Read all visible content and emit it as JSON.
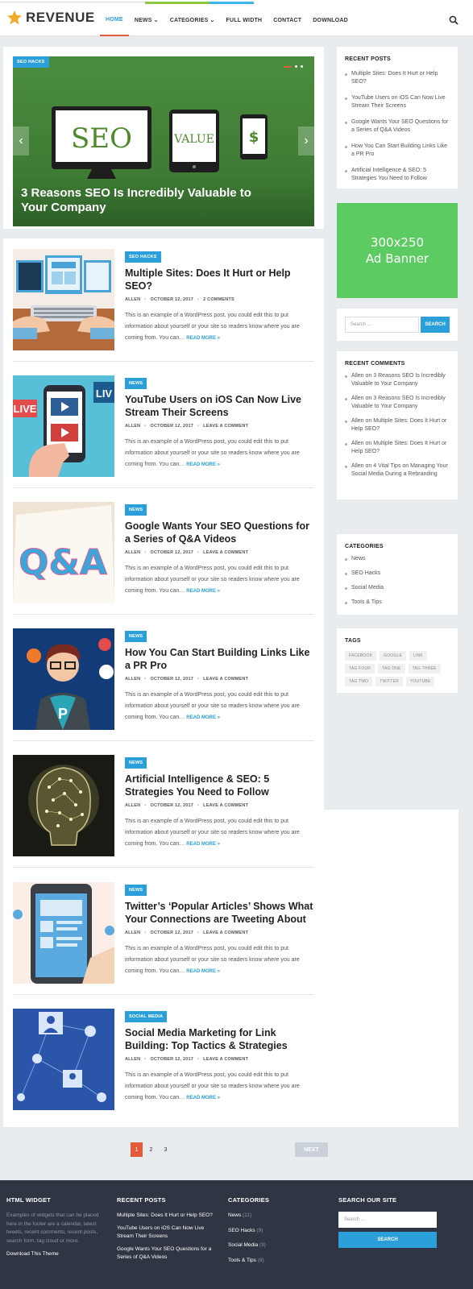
{
  "site": {
    "logo_text": "REVENUE"
  },
  "nav": {
    "items": [
      {
        "label": "HOME",
        "active": true,
        "dropdown": false
      },
      {
        "label": "NEWS",
        "active": false,
        "dropdown": true
      },
      {
        "label": "CATEGORIES",
        "active": false,
        "dropdown": true
      },
      {
        "label": "FULL WIDTH",
        "active": false,
        "dropdown": false
      },
      {
        "label": "CONTACT",
        "active": false,
        "dropdown": false
      },
      {
        "label": "DOWNLOAD",
        "active": false,
        "dropdown": false
      }
    ],
    "search_icon": "search-icon"
  },
  "slider": {
    "tag": "SEO HACKS",
    "title": "3 Reasons SEO Is Incredibly Valuable to Your Company",
    "screen_words": [
      "SEO",
      "VALUE",
      "$"
    ],
    "prev_icon": "chevron-left-icon",
    "next_icon": "chevron-right-icon"
  },
  "posts": [
    {
      "category": "SEO HACKS",
      "title": "Multiple Sites: Does It Hurt or Help SEO?",
      "author": "ALLEN",
      "date": "OCTOBER 12, 2017",
      "comments": "2 COMMENTS",
      "excerpt": "This is an example of a WordPress post, you could edit this to put information about yourself or your site so readers know where you are coming from. You can…",
      "read_more": "READ MORE »"
    },
    {
      "category": "NEWS",
      "title": "YouTube Users on iOS Can Now Live Stream Their Screens",
      "author": "ALLEN",
      "date": "OCTOBER 12, 2017",
      "comments": "LEAVE A COMMENT",
      "excerpt": "This is an example of a WordPress post, you could edit this to put information about yourself or your site so readers know where you are coming from. You can…",
      "read_more": "READ MORE »"
    },
    {
      "category": "NEWS",
      "title": "Google Wants Your SEO Questions for a Series of Q&A Videos",
      "author": "ALLEN",
      "date": "OCTOBER 12, 2017",
      "comments": "LEAVE A COMMENT",
      "excerpt": "This is an example of a WordPress post, you could edit this to put information about yourself or your site so readers know where you are coming from. You can…",
      "read_more": "READ MORE »"
    },
    {
      "category": "NEWS",
      "title": "How You Can Start Building Links Like a PR Pro",
      "author": "ALLEN",
      "date": "OCTOBER 12, 2017",
      "comments": "LEAVE A COMMENT",
      "excerpt": "This is an example of a WordPress post, you could edit this to put information about yourself or your site so readers know where you are coming from. You can…",
      "read_more": "READ MORE »"
    },
    {
      "category": "NEWS",
      "title": "Artificial Intelligence & SEO: 5 Strategies You Need to Follow",
      "author": "ALLEN",
      "date": "OCTOBER 12, 2017",
      "comments": "LEAVE A COMMENT",
      "excerpt": "This is an example of a WordPress post, you could edit this to put information about yourself or your site so readers know where you are coming from. You can…",
      "read_more": "READ MORE »"
    },
    {
      "category": "NEWS",
      "title": "Twitter’s ‘Popular Articles’ Shows What Your Connections are Tweeting About",
      "author": "ALLEN",
      "date": "OCTOBER 12, 2017",
      "comments": "LEAVE A COMMENT",
      "excerpt": "This is an example of a WordPress post, you could edit this to put information about yourself or your site so readers know where you are coming from. You can…",
      "read_more": "READ MORE »"
    },
    {
      "category": "SOCIAL MEDIA",
      "title": "Social Media Marketing for Link Building: Top Tactics & Strategies",
      "author": "ALLEN",
      "date": "OCTOBER 12, 2017",
      "comments": "LEAVE A COMMENT",
      "excerpt": "This is an example of a WordPress post, you could edit this to put information about yourself or your site so readers know where you are coming from. You can…",
      "read_more": "READ MORE »"
    }
  ],
  "thumb_art": {
    "qa_text": "Q&A",
    "live_text": "LIVE",
    "live_short": "LIV",
    "hero_letter": "P"
  },
  "pagination": {
    "pages": [
      "1",
      "2",
      "3"
    ],
    "current": "1",
    "next": "NEXT"
  },
  "sidebar": {
    "recent_posts": {
      "title": "RECENT POSTS",
      "items": [
        "Multiple Sites: Does It Hurt or Help SEO?",
        "YouTube Users on iOS Can Now Live Stream Their Screens",
        "Google Wants Your SEO Questions for a Series of Q&A Videos",
        "How You Can Start Building Links Like a PR Pro",
        "Artificial Intelligence & SEO: 5 Strategies You Need to Follow"
      ]
    },
    "ad": {
      "line1": "300x250",
      "line2": "Ad Banner",
      "color": "#5ccc62"
    },
    "search": {
      "placeholder": "Search …",
      "button": "SEARCH"
    },
    "recent_comments": {
      "title": "RECENT COMMENTS",
      "items": [
        {
          "author": "Allen",
          "on": "on",
          "post": "3 Reasons SEO Is Incredibly Valuable to Your Company"
        },
        {
          "author": "Allen",
          "on": "on",
          "post": "3 Reasons SEO Is Incredibly Valuable to Your Company"
        },
        {
          "author": "Allen",
          "on": "on",
          "post": "Multiple Sites: Does It Hurt or Help SEO?"
        },
        {
          "author": "Allen",
          "on": "on",
          "post": "Multiple Sites: Does It Hurt or Help SEO?"
        },
        {
          "author": "Allen",
          "on": "on",
          "post": "4 Vital Tips on Managing Your Social Media During a Rebranding"
        }
      ]
    },
    "categories": {
      "title": "CATEGORIES",
      "items": [
        "News",
        "SEO Hacks",
        "Social Media",
        "Tools & Tips"
      ]
    },
    "tags": {
      "title": "TAGS",
      "items": [
        "FACEBOOK",
        "GOOGLE",
        "LINK",
        "TAG FOUR",
        "TAG ONE",
        "TAG THREE",
        "TAG TWO",
        "TWITTER",
        "YOUTUBE"
      ]
    }
  },
  "footer": {
    "html_widget": {
      "title": "HTML WIDGET",
      "text": "Examples of widgets that can be placed here in the footer are a calendar, latest tweets, recent comments, recent posts, search form, tag cloud or more.",
      "link": "Download This Theme"
    },
    "recent_posts": {
      "title": "RECENT POSTS",
      "items": [
        "Multiple Sites: Does It Hurt or Help SEO?",
        "YouTube Users on iOS Can Now Live Stream Their Screens",
        "Google Wants Your SEO Questions for a Series of Q&A Videos"
      ]
    },
    "categories": {
      "title": "CATEGORIES",
      "items": [
        {
          "name": "News",
          "count": "(11)"
        },
        {
          "name": "SEO Hacks",
          "count": "(9)"
        },
        {
          "name": "Social Media",
          "count": "(9)"
        },
        {
          "name": "Tools & Tips",
          "count": "(8)"
        }
      ]
    },
    "search": {
      "title": "SEARCH OUR SITE",
      "placeholder": "Search …",
      "button": "SEARCH"
    }
  },
  "colors": {
    "accent": "#2b9fd9",
    "highlight": "#e35b3c",
    "footer_bg": "#2f3543",
    "page_bg": "#e9ecef"
  }
}
